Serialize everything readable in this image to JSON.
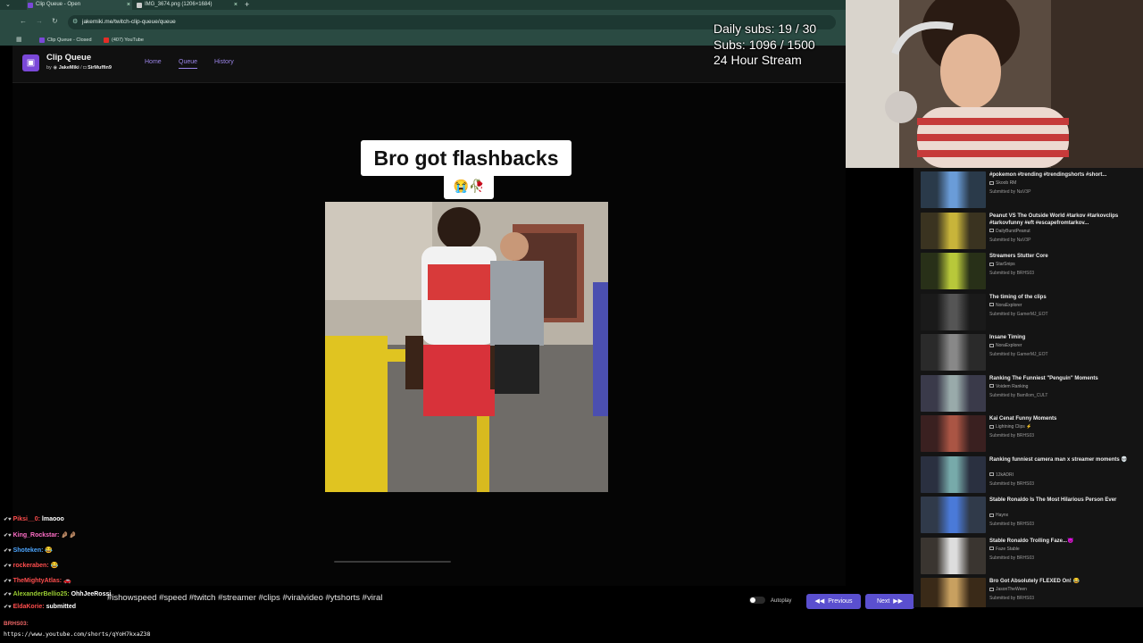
{
  "browser": {
    "tabs": [
      {
        "title": "Clip Queue - Open"
      },
      {
        "title": "IMG_3674.png (1206×1684)"
      }
    ],
    "url": "jakemiki.me/twitch-clip-queue/queue",
    "bookmarks": [
      {
        "label": "Clip Queue - Closed"
      },
      {
        "label": "(407) YouTube"
      }
    ]
  },
  "app": {
    "title": "Clip Queue",
    "by": "by",
    "author1": "JakeMiki",
    "author2": "SirMuffin9",
    "nav": [
      {
        "label": "Home"
      },
      {
        "label": "Queue"
      },
      {
        "label": "History"
      }
    ]
  },
  "video": {
    "caption": "Bro got flashbacks",
    "caption_emoji": "😭🥀",
    "hashtags": "#ishowspeed #speed #twitch #streamer #clips #viralvideo #ytshorts #viral"
  },
  "controls": {
    "autoplay_label": "Autoplay",
    "previous_label": "Previous",
    "next_label": "Next"
  },
  "stats": {
    "line1": "Daily subs: 19 / 30",
    "line2": "Subs: 1096 / 1500",
    "line3": "24 Hour Stream"
  },
  "queue": [
    {
      "title": "#pokemon #trending #trendingshorts #short...",
      "channel": "Skoob RM",
      "submitted": "Submitted by NaV3P"
    },
    {
      "title": "Peanut VS The Outside World #tarkov #tarkovclips #tarkovfunny #eft #escapefromtarkov...",
      "channel": "DailyBurstPeanut",
      "submitted": "Submitted by NaV3P"
    },
    {
      "title": "Streamers Stutter Core",
      "channel": "StarSnips",
      "submitted": "Submitted by BRHS03"
    },
    {
      "title": "The timing of the clips",
      "channel": "NoraExplorer",
      "submitted": "Submitted by GamerMJ_EOT"
    },
    {
      "title": "Insane Timing",
      "channel": "NoraExplorer",
      "submitted": "Submitted by GamerMJ_EOT"
    },
    {
      "title": "Ranking The Funniest \"Penguin\" Moments",
      "channel": "Voidem Ranking",
      "submitted": "Submitted by Bamllom_CULT"
    },
    {
      "title": "Kai Cenat Funny Moments",
      "channel": "Lightning Clips ⚡",
      "submitted": "Submitted by BRHS03"
    },
    {
      "title": "Ranking funniest camera man x streamer moments 💀",
      "channel": "12kADRI",
      "submitted": "Submitted by BRHS03"
    },
    {
      "title": "Stable Ronaldo Is The Most Hilarious Person Ever",
      "channel": "Haynx",
      "submitted": "Submitted by BRHS03"
    },
    {
      "title": "Stable Ronaldo Trolling Faze...😈",
      "channel": "Faze Stable",
      "submitted": "Submitted by BRHS03"
    },
    {
      "title": "Bro Got Absolutely FLEXED On! 😂",
      "channel": "JasonTheWeen",
      "submitted": "Submitted by BRHS03"
    }
  ],
  "chat": [
    {
      "user": "Piksi__0:",
      "message": "lmaooo",
      "color": "#ff4d4d"
    },
    {
      "user": "King_Rockstar:",
      "message": "🤌🏽🤌🏽",
      "color": "#ff6ec7"
    },
    {
      "user": "Shoteken:",
      "message": "😂",
      "color": "#4da6ff"
    },
    {
      "user": "rockeraben:",
      "message": "😂",
      "color": "#ff4d4d"
    },
    {
      "user": "TheMightyAtlas:",
      "message": "🚗",
      "color": "#ff4d4d"
    },
    {
      "user": "AlexanderBellio25:",
      "message": "OhhJeeRossi",
      "color": "#9acd32"
    },
    {
      "user": "EldaKorie:",
      "message": "submitted",
      "color": "#ff4d4d"
    }
  ],
  "chat_last_user": "BRHS03:",
  "chat_last_url": "https://www.youtube.com/shorts/qYoH7kxaZ38"
}
